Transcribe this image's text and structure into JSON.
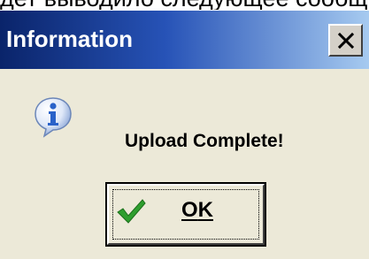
{
  "background_text": "дет выводило следующее сообщ",
  "dialog": {
    "title": "Information",
    "message": "Upload Complete!",
    "ok_button": {
      "label": "OK",
      "mnemonic": "O",
      "rest": "K"
    },
    "close_glyph": "X"
  },
  "icons": {
    "info": "info-icon",
    "check": "checkmark-icon",
    "close": "close-icon"
  },
  "colors": {
    "titlebar_start": "#0a246a",
    "titlebar_end": "#a6caf0",
    "dialog_bg": "#ece9d8",
    "check_green": "#2e9e2e",
    "info_blue": "#2a62c9"
  }
}
